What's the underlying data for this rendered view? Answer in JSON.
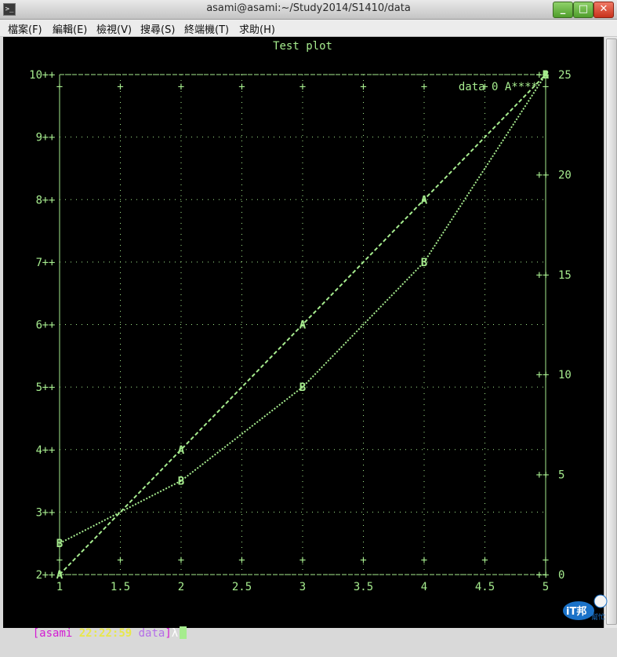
{
  "window": {
    "title": "asami@asami:~/Study2014/S1410/data",
    "icon": "terminal-icon",
    "controls": {
      "minimize": "_",
      "maximize": "□",
      "close": "✕"
    }
  },
  "menu": [
    {
      "label": "檔案(F)"
    },
    {
      "label": "編輯(E)"
    },
    {
      "label": "檢視(V)"
    },
    {
      "label": "搜尋(S)"
    },
    {
      "label": "終端機(T)"
    },
    {
      "label": "求助(H)"
    }
  ],
  "colors": {
    "terminal_bg": "#000000",
    "plot_fg": "#a6ec8e",
    "prompt_user": "#d31bd3",
    "prompt_time": "#e8e84a",
    "prompt_dir": "#b46ee8"
  },
  "chart_data": {
    "type": "line",
    "title": "Test plot",
    "renderer": "gnuplot dumb terminal (ASCII)",
    "x": [
      1,
      2,
      3,
      4,
      5
    ],
    "xlim": [
      1,
      5
    ],
    "ylim": [
      2,
      10
    ],
    "y2lim": [
      0,
      25
    ],
    "xticks": [
      "1",
      "1.5",
      "2",
      "2.5",
      "3",
      "3.5",
      "4",
      "4.5",
      "5"
    ],
    "yticks": [
      "2",
      "3",
      "4",
      "5",
      "6",
      "7",
      "8",
      "9",
      "10"
    ],
    "y2ticks": [
      "0",
      "5",
      "10",
      "15",
      "20",
      "25"
    ],
    "grid": true,
    "legend_position": "top-right",
    "series": [
      {
        "name": "data 0",
        "marker": "A",
        "line": "**",
        "values": [
          2,
          4,
          6,
          8,
          10
        ]
      },
      {
        "name": "",
        "marker": "B",
        "line": "##",
        "values": [
          2.5,
          3.5,
          5,
          7,
          10
        ]
      }
    ]
  },
  "prompt": {
    "open": "[",
    "user": "asami",
    "time": "22:22:59",
    "dir": "data",
    "close": "]",
    "symbol": "λ"
  },
  "watermark": {
    "text": "iT邦",
    "sub": "幫忙"
  }
}
